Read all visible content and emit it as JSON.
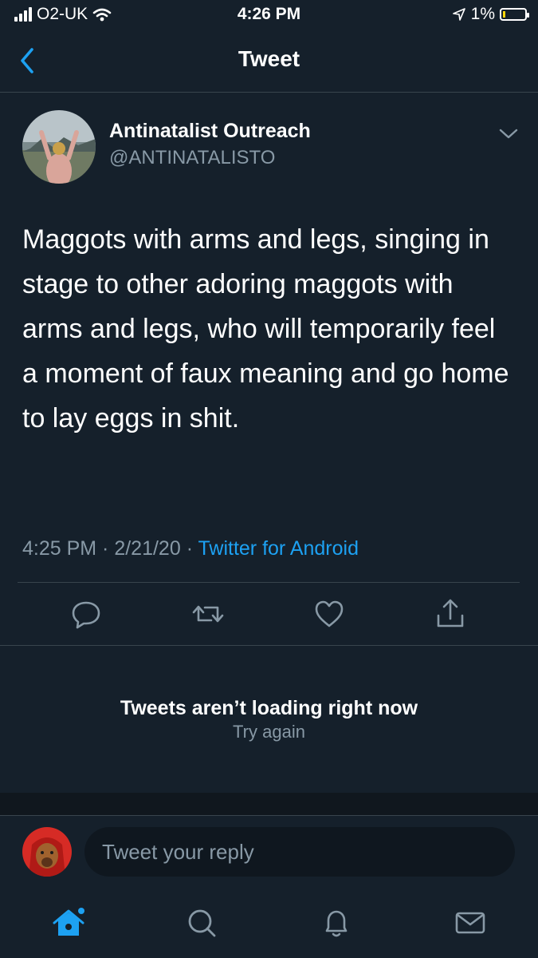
{
  "status_bar": {
    "carrier": "O2-UK",
    "time": "4:26 PM",
    "battery": "1%"
  },
  "header": {
    "title": "Tweet"
  },
  "tweet": {
    "author_name": "Antinatalist Outreach",
    "author_handle": "@ANTINATALISTO",
    "text": "Maggots with arms and legs, singing in stage to other adoring maggots with arms and legs, who will temporarily feel a moment of faux meaning and go home to lay eggs in shit.",
    "time": "4:25 PM",
    "date": "2/21/20",
    "source": "Twitter for Android",
    "separator": " · "
  },
  "error": {
    "title": "Tweets aren’t loading right now",
    "retry": "Try again"
  },
  "reply": {
    "placeholder": "Tweet your reply"
  },
  "colors": {
    "background": "#15202b",
    "accent": "#1da1f2",
    "secondary_text": "#8899a6",
    "divider": "#38444d"
  },
  "icons": {
    "back": "chevron-left-icon",
    "more": "chevron-down-icon",
    "reply": "comment-icon",
    "retweet": "retweet-icon",
    "like": "heart-icon",
    "share": "share-icon",
    "home": "home-icon",
    "search": "search-icon",
    "notifications": "bell-icon",
    "messages": "mail-icon"
  }
}
